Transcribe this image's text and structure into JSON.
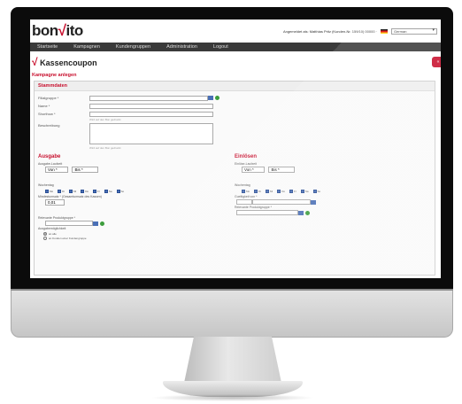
{
  "app": {
    "logo_text_a": "bon",
    "logo_text_b": "ito",
    "logo_tick": "√"
  },
  "header": {
    "user_info": "Angemeldet als: Matthias Pritz (Kunden-Nr. 159/10) 00000 ·",
    "language": "German"
  },
  "nav": [
    "Startseite",
    "Kampagnen",
    "Kundengruppen",
    "Administration",
    "Logout"
  ],
  "page": {
    "title": "Kassencoupon",
    "subtitle": "Kampagne anlegen",
    "back_label": "«"
  },
  "stammdaten": {
    "heading": "Stammdaten",
    "fields": [
      {
        "label": "Filialgruppe *",
        "type": "select"
      },
      {
        "label": "Name *",
        "type": "text"
      },
      {
        "label": "Shorthow *",
        "type": "text",
        "hint": "Wird auf den Bon gedruckt"
      },
      {
        "label": "Beschreibung",
        "type": "textarea",
        "hint": "Wird auf den Bon gedruckt"
      }
    ]
  },
  "ausgabe": {
    "heading": "Ausgabe",
    "laufzeit_label": "Ausgabe-Laufzeit",
    "von": "Von *",
    "bis": "Bis *",
    "wochentag_label": "Wochentag",
    "days": [
      "Mo",
      "Di",
      "Mi",
      "Do",
      "Fr",
      "Sa",
      "So"
    ],
    "mindestumsatz_label": "Mindestumsatz * (Gesamtumsatz des Kassen)",
    "mindestumsatz_value": "0,01",
    "produktgruppe_label": "Relevante Produktgruppe *",
    "ausgabemoeglichkeit_label": "Ausgabemöglichkeit",
    "radio_options": [
      "an alle",
      "an Kunden einer Kundengruppe"
    ]
  },
  "einloesen": {
    "heading": "Einlösen",
    "laufzeit_label": "Einlöse-Laufzeit",
    "von": "Von *",
    "bis": "Bis *",
    "wochentag_label": "Wochentag",
    "days": [
      "Mo",
      "Di",
      "Mi",
      "Do",
      "Fr",
      "Sa",
      "So"
    ],
    "gueltig_label": "Gueltigkeit von *",
    "produktgruppe_label": "Relevante Produktgruppe *"
  },
  "colors": {
    "brand_red": "#c8102e",
    "nav_bg": "#3a3a3a",
    "checkbox_blue": "#4a6fb5",
    "add_green": "#3c9d3c"
  }
}
